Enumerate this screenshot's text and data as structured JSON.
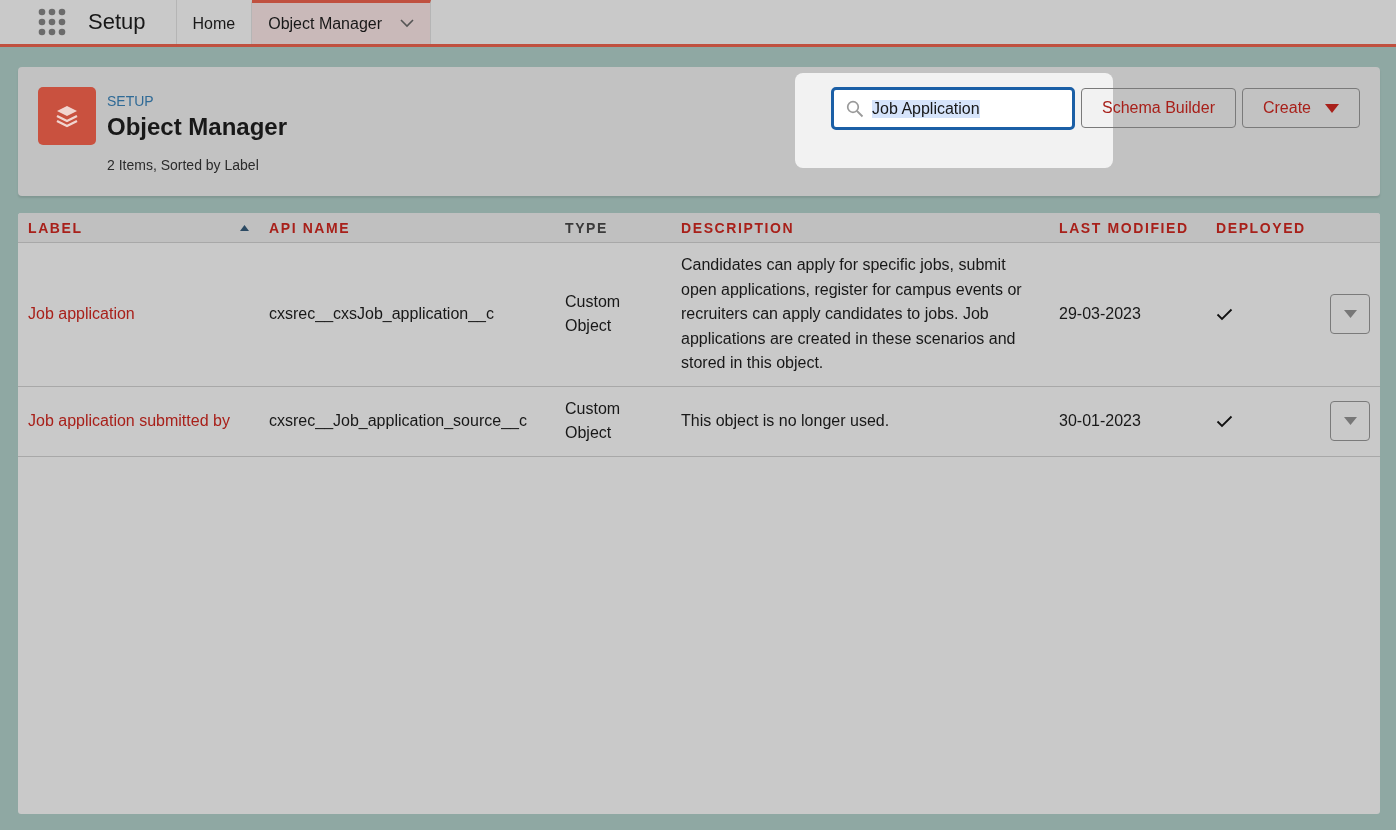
{
  "top_bar": {
    "app_name": "Setup",
    "tabs": [
      {
        "label": "Home",
        "selected": false,
        "has_menu": false
      },
      {
        "label": "Object Manager",
        "selected": true,
        "has_menu": true
      }
    ]
  },
  "header": {
    "breadcrumb": "SETUP",
    "title": "Object Manager",
    "subtitle": "2 Items, Sorted by Label",
    "search": {
      "value": "Job Application",
      "text_selected": true
    },
    "buttons": [
      {
        "label": "Schema Builder",
        "has_menu": false
      },
      {
        "label": "Create",
        "has_menu": true
      }
    ]
  },
  "table": {
    "columns": [
      {
        "label": "LABEL",
        "sortable": true,
        "sorted": true
      },
      {
        "label": "API NAME",
        "sortable": true,
        "sorted": false
      },
      {
        "label": "TYPE",
        "sortable": false,
        "sorted": false
      },
      {
        "label": "DESCRIPTION",
        "sortable": true,
        "sorted": false
      },
      {
        "label": "LAST MODIFIED",
        "sortable": true,
        "sorted": false
      },
      {
        "label": "DEPLOYED",
        "sortable": true,
        "sorted": false
      }
    ],
    "rows": [
      {
        "label": "Job application",
        "api_name": "cxsrec__cxsJob_application__c",
        "type": "Custom Object",
        "description": "Candidates can apply for specific jobs, submit open applications, register for campus events or recruiters can apply candidates to jobs. Job applications are created in these scenarios and stored in this object.",
        "last_modified": "29-03-2023",
        "deployed": true
      },
      {
        "label": "Job application submitted by",
        "api_name": "cxsrec__Job_application_source__c",
        "type": "Custom Object",
        "description": "This object is no longer used.",
        "last_modified": "30-01-2023",
        "deployed": true
      }
    ]
  }
}
